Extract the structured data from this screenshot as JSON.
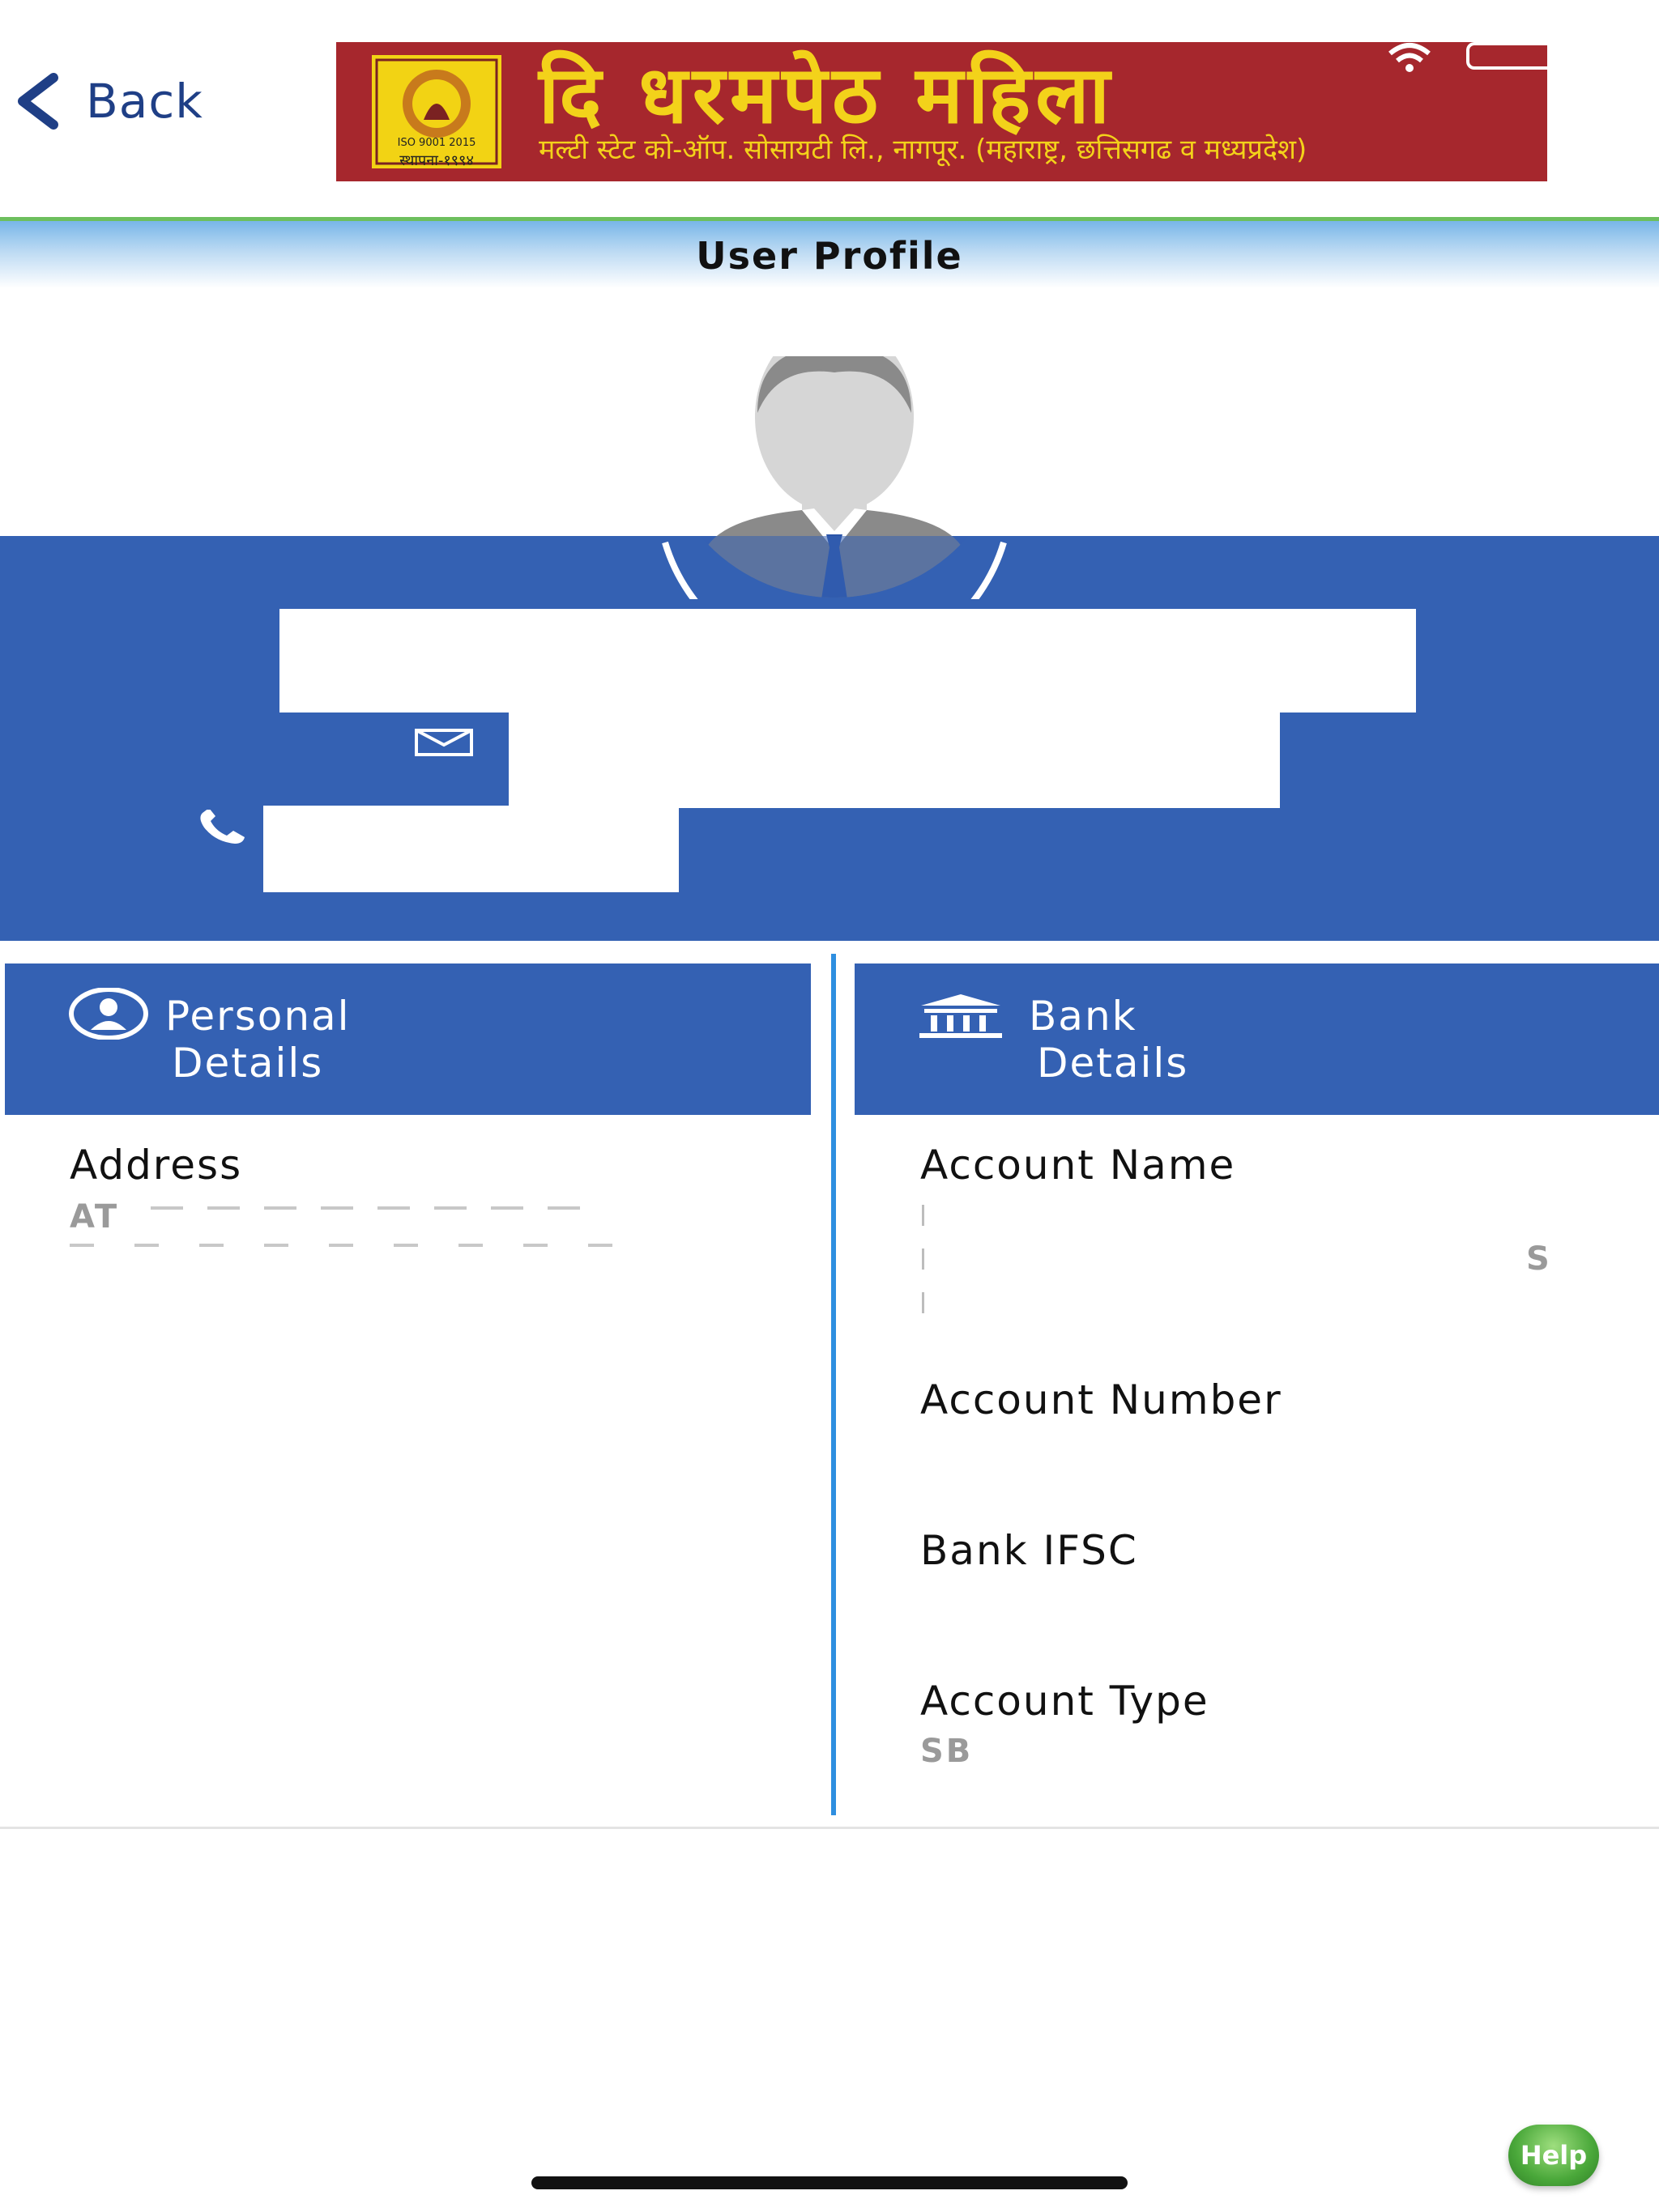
{
  "header": {
    "back_label": "Back",
    "banner_title": "दि  धरमपेठ  महिला",
    "banner_subtitle": "मल्टी स्टेट को-ऑप. सोसायटी लि., नागपूर. (महाराष्ट्र, छत्तिसगढ व मध्यप्रदेश)",
    "seal_iso": "ISO 9001 2015",
    "seal_est": "स्थापना-१९९४"
  },
  "page_title": "User Profile",
  "personal": {
    "heading_line1": "Personal",
    "heading_line2": "Details",
    "address_label": "Address",
    "address_value_line1": "AT",
    "address_value_line2": ""
  },
  "bank": {
    "heading_line1": "Bank",
    "heading_line2": "Details",
    "account_name_label": "Account Name",
    "account_name_value": "S",
    "account_number_label": "Account Number",
    "ifsc_label": "Bank IFSC",
    "account_type_label": "Account Type",
    "account_type_value": "SB"
  },
  "help_label": "Help",
  "colors": {
    "primary_blue": "#3461b3",
    "banner_red": "#a6272d",
    "banner_yellow": "#f3d21a",
    "divider_blue": "#2e8fe0",
    "help_green": "#4aa83a"
  }
}
